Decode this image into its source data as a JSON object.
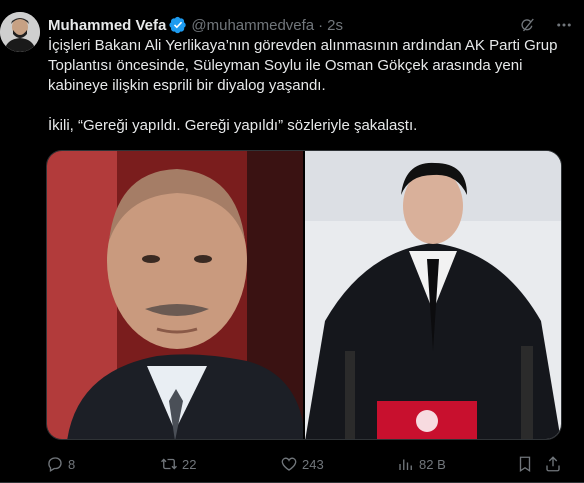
{
  "tweet": {
    "author_name": "Muhammed Vefa",
    "handle": "@muhammedvefa",
    "separator": "·",
    "time": "2s",
    "paragraph1": "İçişleri Bakanı Ali Yerlikaya’nın görevden alınmasının ardından AK Parti Grup Toplantısı öncesinde, Süleyman Soylu ile Osman Gökçek arasında yeni kabineye ilişkin esprili bir diyalog yaşandı.",
    "paragraph2": "İkili, “Gereği yapıldı. Gereği yapıldı” sözleriyle şakalaştı."
  },
  "header_icons": [
    "grok-icon",
    "more-icon"
  ],
  "stats": {
    "replies": "8",
    "reposts": "22",
    "likes": "243",
    "views": "82 B"
  },
  "colors": {
    "background": "#000000",
    "text": "#e7e9ea",
    "muted": "#71767b",
    "verified": "#1d9bf0",
    "border": "#2f3336"
  }
}
